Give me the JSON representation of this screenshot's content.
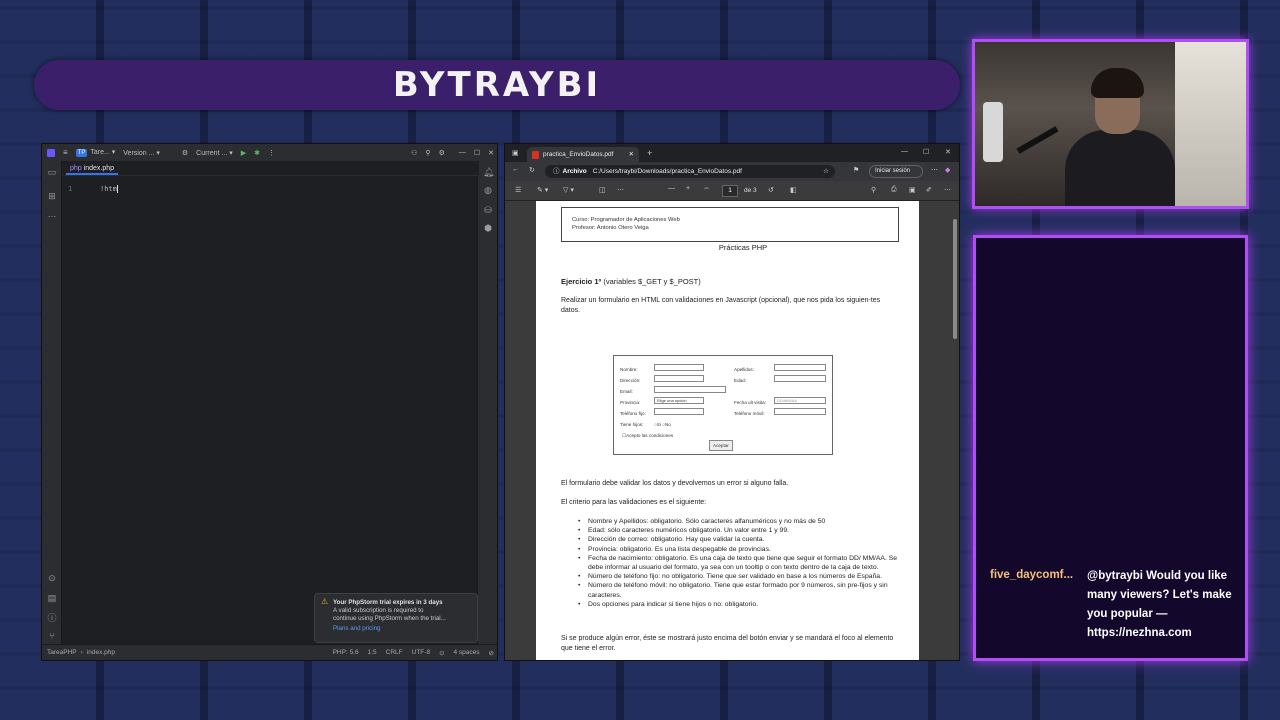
{
  "banner": {
    "title": "BYTRAYBI"
  },
  "ide": {
    "project_badge": "TP",
    "project": "Tare...",
    "vcs": "Version ...",
    "run_config": "Current ...",
    "file_tab": "index.php",
    "line_number": "1",
    "code": "!htm",
    "trial": {
      "title": "Your PhpStorm trial expires in 3 days",
      "body1": "A valid subscription is required to",
      "body2": "continue using PhpStorm when the trial...",
      "link": "Plans and pricing"
    },
    "status": {
      "breadcrumb_project": "TareaPHP",
      "breadcrumb_file": "index.php",
      "php": "PHP: 5.6",
      "position": "1:5",
      "line_sep": "CRLF",
      "encoding": "UTF-8",
      "indent": "4 spaces"
    }
  },
  "browser": {
    "tab_title": "practica_EnvioDatos.pdf",
    "url_label": "Archivo",
    "url": "C:/Users/traybi/Downloads/practica_EnvioDatos.pdf",
    "signin": "Iniciar sesión",
    "page": "1",
    "page_of": "de 3"
  },
  "pdf": {
    "course": "Curso: Programador de Aplicaciones Web",
    "teacher": "Profesor: Antonio Otero Veiga",
    "title": "Prácticas PHP",
    "exercise_bold": "Ejercicio 1º",
    "exercise_rest": "(variables $_GET y $_POST)",
    "exercise_desc": "Realizar un formulario en HTML con validaciones en Javascript (opcional), que nos pida los siguien-tes datos.",
    "form": {
      "nombre": "Nombre:",
      "apellidos": "Apellidos:",
      "direccion": "Dirección:",
      "edad": "Edad:",
      "email": "Email:",
      "provincia": "Provincia:",
      "provincia_select": "Elige una opción",
      "fecha": "Fecha ult visita:",
      "fecha_placeholder": "DD/MM/AA",
      "telefono_fijo": "Teléfono fijo:",
      "telefono_movil": "Teléfono móvil:",
      "hijos": "Tiene hijos:",
      "si": "Si",
      "no": "No",
      "acepto": "Acepto las condiciones",
      "aceptar": "Aceptar"
    },
    "p_validate": "El formulario debe validar los datos y devolvemos un error si alguno falla.",
    "p_criteria": "El criterio para las validaciones es el siguiente:",
    "rules": [
      "Nombre y Apellidos: obligatorio. Sólo caracteres alfanuméricos y no más de 50",
      "Edad: sólo caracteres numéricos obligatorio. Un valor entre 1 y 99.",
      "Dirección de correo: obligatorio. Hay que validar la cuenta.",
      "Provincia: obligatorio. Es una lista despegable de provincias.",
      "Fecha de nacimiento: obligatorio. Es una caja de texto que tiene que seguir el formato DD/ MM/AA. Se debe informar al usuario del formato, ya sea con un tooltip o con texto dentro de la caja de texto.",
      "Número de teléfono fijo: no obligatorio. Tiene que ser validado en base a los números de España.",
      "Número de teléfono móvil: no obligatorio. Tiene que estar formado por 9 números, sin pre-fijos y sin caracteres.",
      "Dos opciones para indicar si tiene hijos o no: obligatorio."
    ],
    "p_error": "Si se produce algún error, éste se mostrará justo encima del botón enviar y se mandará el foco al elemento que tiene el error."
  },
  "chat": {
    "user": "five_daycomf...",
    "message": "@bytraybi Would you like many viewers? Let's make you popular — https://nezhna.com"
  },
  "colors": {
    "accent": "#b24cf5",
    "banner": "#3c1f6a",
    "chat_user": "#f4c07a"
  }
}
